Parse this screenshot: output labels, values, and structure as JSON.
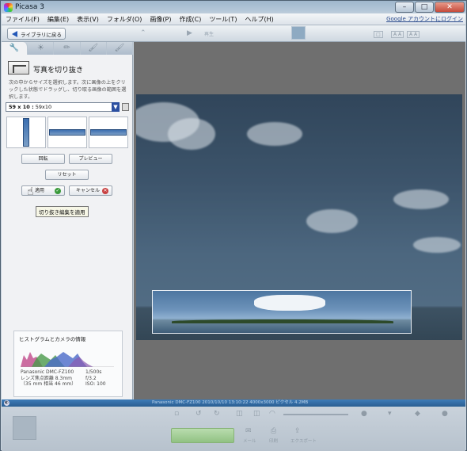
{
  "window": {
    "title": "Picasa 3",
    "minimize": "–",
    "maximize": "□",
    "close": "✕"
  },
  "menu": {
    "items": [
      "ファイル(F)",
      "編集(E)",
      "表示(V)",
      "フォルダ(O)",
      "画像(P)",
      "作成(C)",
      "ツール(T)",
      "ヘルプ(H)"
    ],
    "account_link": "Google アカウントにログイン"
  },
  "toolbar": {
    "back_label": "ライブラリに戻る",
    "play_label": "再生",
    "size_boxes": [
      "□",
      "A A",
      "A A"
    ]
  },
  "panel": {
    "tabs": [
      "🔧",
      "☀",
      "✏",
      "🖌",
      "🖌"
    ],
    "title": "写真を切り抜き",
    "description": "次の中からサイズを選択します。次に画像の上をクリックした状態でドラッグし、切り取る画像の範囲を選択します。",
    "aspect": {
      "value_bold": "59 x 10 :",
      "value_small": "59x10"
    },
    "buttons": {
      "rotate": "回転",
      "preview": "プレビュー",
      "reset": "リセット",
      "apply": "適用",
      "cancel": "キャンセル"
    },
    "tooltip": "切り抜き編集を適用"
  },
  "histogram": {
    "title": "ヒストグラムとカメラの情報",
    "camera_left": [
      "Panasonic DMC-FZ100",
      "レンズ焦点距離 8.3mm",
      "（35 mm 相当 46 mm）"
    ],
    "camera_right": [
      "1/500s",
      "f/3.2",
      "ISO: 100"
    ]
  },
  "status": {
    "info": "Panasonic DMC-FZ100 2010/10/10 13:10:22 4000x3000 ピクセル 4.2MB"
  },
  "bottom": {
    "labels": [
      "メール",
      "印刷",
      "エクスポート"
    ]
  },
  "colors": {
    "status_bar": "#2f6aa3",
    "select_dropdown": "#2b4fa0",
    "apply_check": "#3a9a3a",
    "cancel_x": "#c84040"
  }
}
